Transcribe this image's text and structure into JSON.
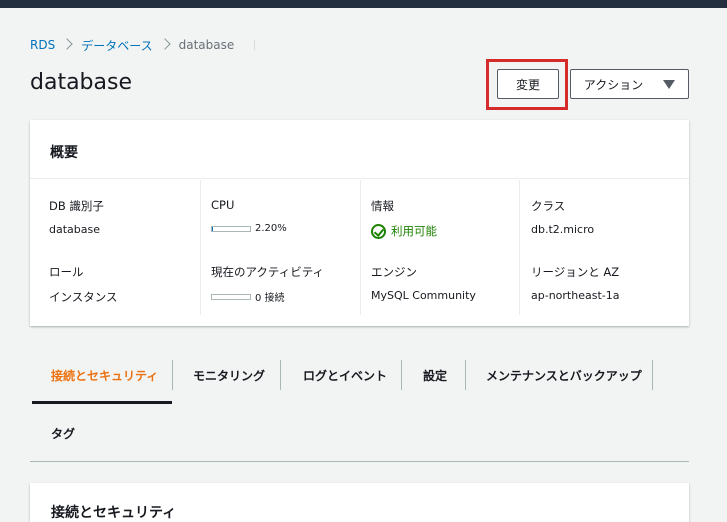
{
  "breadcrumb": {
    "root": "RDS",
    "parent": "データベース",
    "current": "database"
  },
  "page": {
    "title": "database"
  },
  "buttons": {
    "edit": "変更",
    "actions": "アクション"
  },
  "summary": {
    "heading": "概要",
    "fields": {
      "db_identifier": {
        "label": "DB 識別子",
        "value": "database"
      },
      "role": {
        "label": "ロール",
        "value": "インスタンス"
      },
      "cpu": {
        "label": "CPU",
        "value": "2.20%",
        "percent": 2.2
      },
      "activity": {
        "label": "現在のアクティビティ",
        "value": "0 接続",
        "fraction": 0
      },
      "info": {
        "label": "情報",
        "value": "利用可能"
      },
      "engine": {
        "label": "エンジン",
        "value": "MySQL Community"
      },
      "class": {
        "label": "クラス",
        "value": "db.t2.micro"
      },
      "region": {
        "label": "リージョンと AZ",
        "value": "ap-northeast-1a"
      }
    }
  },
  "tabs": [
    {
      "label": "接続とセキュリティ",
      "active": true
    },
    {
      "label": "モニタリング",
      "active": false
    },
    {
      "label": "ログとイベント",
      "active": false
    },
    {
      "label": "設定",
      "active": false
    },
    {
      "label": "メンテナンスとバックアップ",
      "active": false
    },
    {
      "label": "タグ",
      "active": false
    }
  ],
  "section": {
    "title": "接続とセキュリティ"
  },
  "colors": {
    "accent": "#ec7211",
    "link": "#0073bb",
    "success": "#1d8102",
    "highlight": "#d62b2b",
    "topbar": "#232f3e"
  }
}
